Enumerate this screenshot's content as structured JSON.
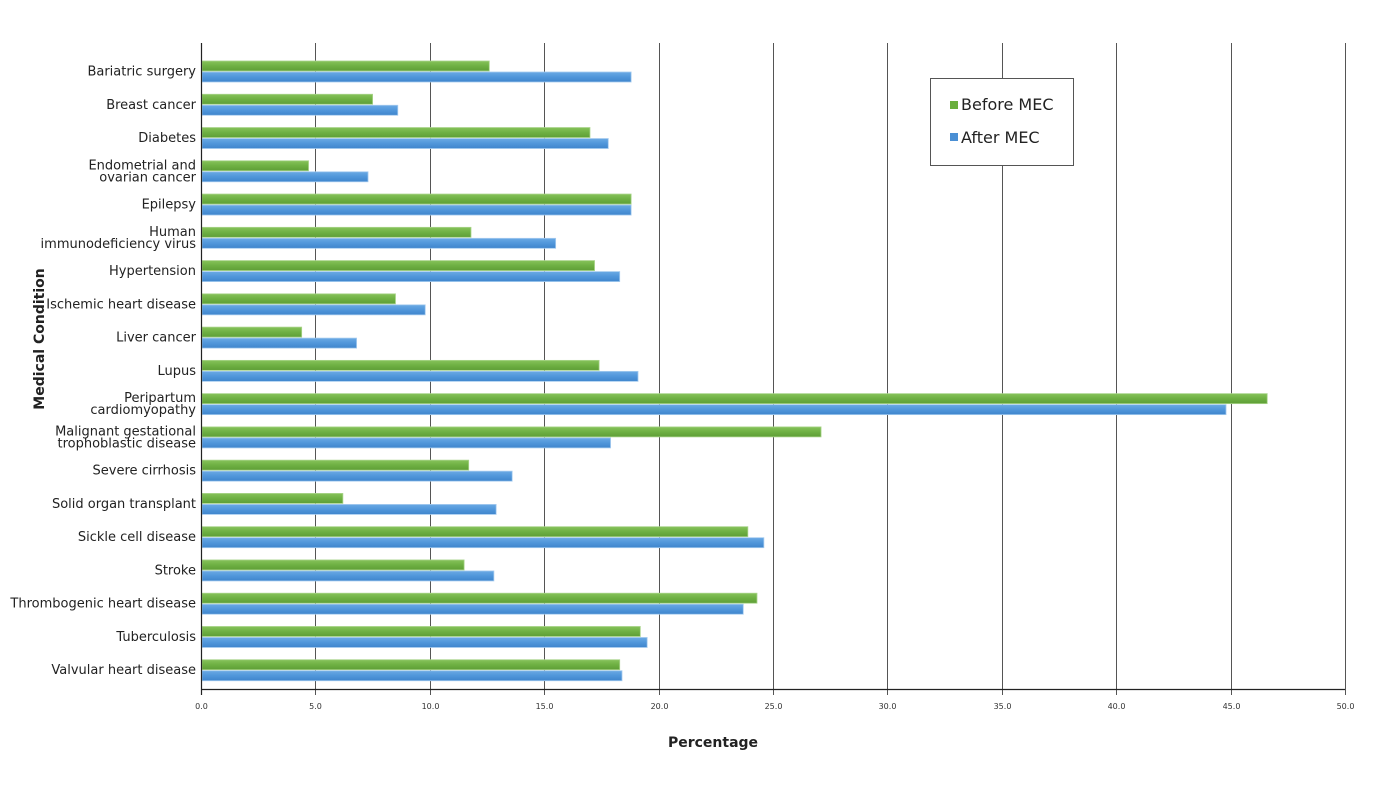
{
  "chart_data": {
    "type": "bar",
    "orientation": "horizontal",
    "title": "",
    "xlabel": "Percentage",
    "ylabel": "Medical Condition",
    "xlim": [
      0,
      50
    ],
    "xticks": [
      "0.0",
      "5.0",
      "10.0",
      "15.0",
      "20.0",
      "25.0",
      "30.0",
      "35.0",
      "40.0",
      "45.0",
      "50.0"
    ],
    "grid": "vertical",
    "legend_position": "top-right",
    "categories": [
      [
        "Bariatric surgery"
      ],
      [
        "Breast cancer"
      ],
      [
        "Diabetes"
      ],
      [
        "Endometrial and",
        "ovarian cancer"
      ],
      [
        "Epilepsy"
      ],
      [
        "Human",
        "immunodeficiency virus"
      ],
      [
        "Hypertension"
      ],
      [
        "Ischemic heart disease"
      ],
      [
        "Liver cancer"
      ],
      [
        "Lupus"
      ],
      [
        "Peripartum",
        "cardiomyopathy"
      ],
      [
        "Malignant gestational",
        "trophoblastic disease"
      ],
      [
        "Severe cirrhosis"
      ],
      [
        "Solid organ transplant"
      ],
      [
        "Sickle cell disease"
      ],
      [
        "Stroke"
      ],
      [
        "Thrombogenic heart disease"
      ],
      [
        "Tuberculosis"
      ],
      [
        "Valvular heart disease"
      ]
    ],
    "series": [
      {
        "name": "Before MEC",
        "color": "#6aaf3d",
        "values": [
          12.6,
          7.5,
          17.0,
          4.7,
          18.8,
          11.8,
          17.2,
          8.5,
          4.4,
          17.4,
          46.6,
          27.1,
          11.7,
          6.2,
          23.9,
          11.5,
          24.3,
          19.2,
          18.3
        ]
      },
      {
        "name": "After MEC",
        "color": "#4a8fd4",
        "values": [
          18.8,
          8.6,
          17.8,
          7.3,
          18.8,
          15.5,
          18.3,
          9.8,
          6.8,
          19.1,
          44.8,
          17.9,
          13.6,
          12.9,
          24.6,
          12.8,
          23.7,
          19.5,
          18.4
        ]
      }
    ]
  }
}
